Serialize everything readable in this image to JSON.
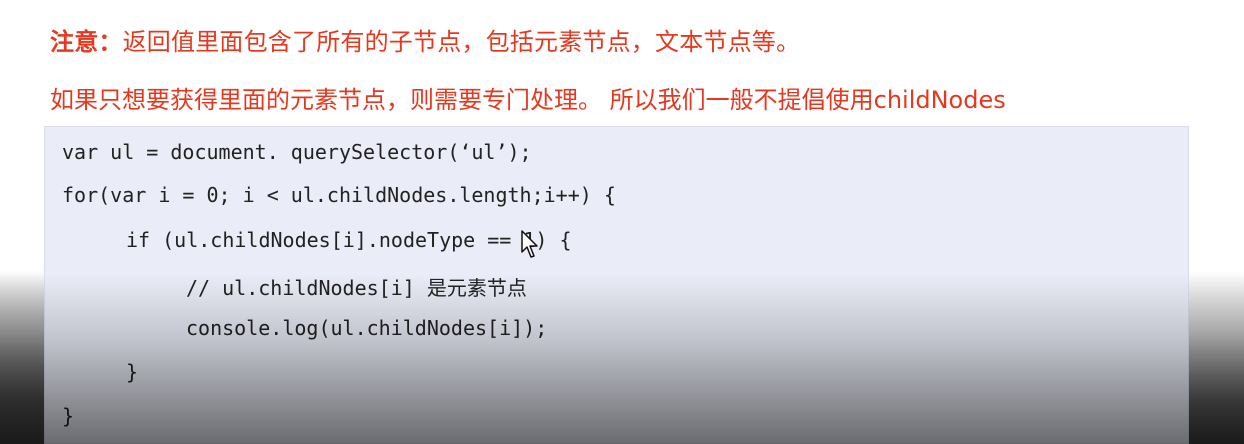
{
  "note": {
    "label": "注意：",
    "text": "返回值里面包含了所有的子节点，包括元素节点，文本节点等。"
  },
  "line2": "如果只想要获得里面的元素节点，则需要专门处理。 所以我们一般不提倡使用childNodes",
  "code": {
    "line1": "var ul = document. querySelector(‘ul’);",
    "line2": "for(var i = 0; i < ul.childNodes.length;i++) {",
    "line3": "if (ul.childNodes[i].nodeType == 1) {",
    "line4_code": "// ul.childNodes[i] ",
    "line4_cn": "是元素节点",
    "line5": "console.log(ul.childNodes[i]);",
    "line6": "}",
    "line7": "}"
  },
  "colors": {
    "accent_red": "#e5391f",
    "code_bg": "#eaedf7",
    "code_text": "#222222"
  },
  "icons": {
    "cursor": "mouse-pointer-icon"
  }
}
